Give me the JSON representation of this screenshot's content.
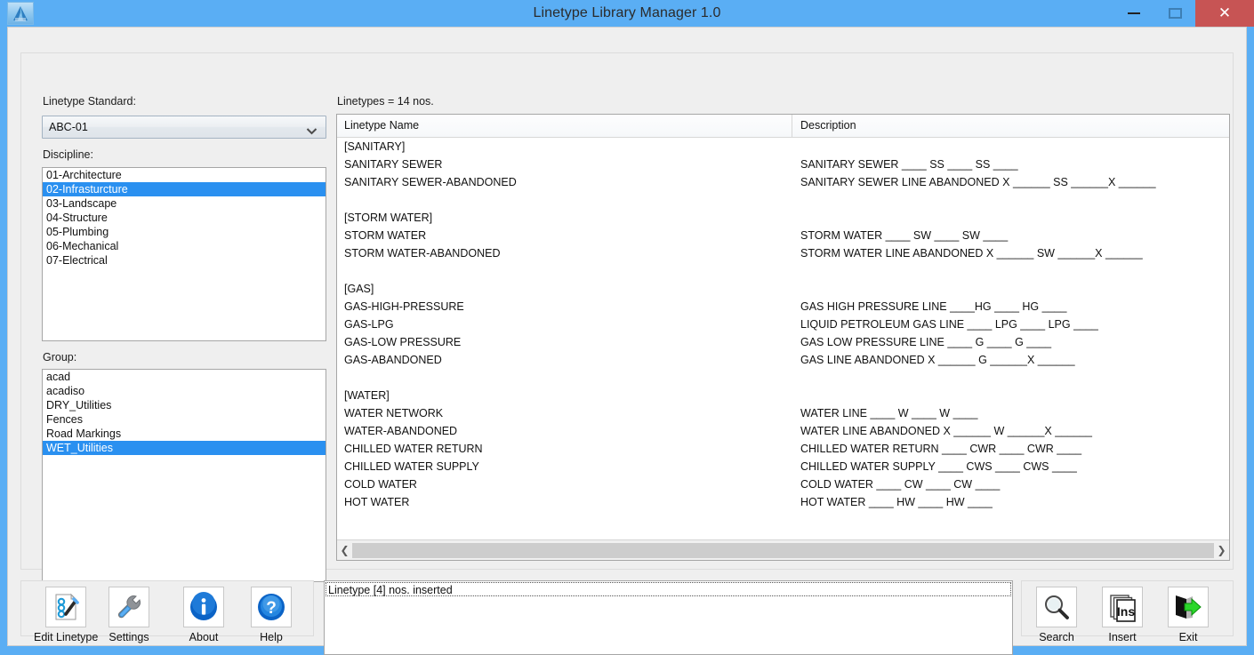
{
  "window": {
    "title": "Linetype Library Manager 1.0",
    "logo_icon": "autocad-logo-icon",
    "minimize_label": "–",
    "maximize_label": "□",
    "close_label": "✕",
    "titlebar_color": "#5aaef4",
    "close_color": "#c75454"
  },
  "left": {
    "standard_label": "Linetype Standard:",
    "standard_value": "ABC-01",
    "discipline_label": "Discipline:",
    "discipline_items": [
      {
        "label": "01-Architecture",
        "selected": false
      },
      {
        "label": "02-Infrasturcture",
        "selected": true
      },
      {
        "label": "03-Landscape",
        "selected": false
      },
      {
        "label": "04-Structure",
        "selected": false
      },
      {
        "label": "05-Plumbing",
        "selected": false
      },
      {
        "label": "06-Mechanical",
        "selected": false
      },
      {
        "label": "07-Electrical",
        "selected": false
      }
    ],
    "group_label": "Group:",
    "group_items": [
      {
        "label": "acad",
        "selected": false
      },
      {
        "label": "acadiso",
        "selected": false
      },
      {
        "label": "DRY_Utilities",
        "selected": false
      },
      {
        "label": "Fences",
        "selected": false
      },
      {
        "label": "Road Markings",
        "selected": false
      },
      {
        "label": "WET_Utilities",
        "selected": true
      }
    ],
    "selection_color": "#2a90f0"
  },
  "main": {
    "count_label": "Linetypes = 14 nos.",
    "col_name": "Linetype Name",
    "col_desc": "Description",
    "rows": [
      {
        "name": "[SANITARY]",
        "desc": ""
      },
      {
        "name": "SANITARY SEWER",
        "desc": "SANITARY SEWER ____ SS ____ SS ____"
      },
      {
        "name": "SANITARY SEWER-ABANDONED",
        "desc": "SANITARY SEWER LINE ABANDONED  X ______ SS ______X ______"
      },
      {
        "name": "",
        "desc": ""
      },
      {
        "name": "[STORM WATER]",
        "desc": ""
      },
      {
        "name": "STORM WATER",
        "desc": "STORM WATER ____ SW ____ SW ____"
      },
      {
        "name": "STORM WATER-ABANDONED",
        "desc": "STORM WATER LINE ABANDONED  X ______ SW ______X ______"
      },
      {
        "name": "",
        "desc": ""
      },
      {
        "name": "[GAS]",
        "desc": ""
      },
      {
        "name": "GAS-HIGH-PRESSURE",
        "desc": "GAS HIGH PRESSURE LINE ____HG ____ HG ____"
      },
      {
        "name": "GAS-LPG",
        "desc": "LIQUID PETROLEUM GAS LINE ____ LPG ____ LPG ____"
      },
      {
        "name": "GAS-LOW PRESSURE",
        "desc": "GAS LOW PRESSURE LINE ____ G ____ G ____"
      },
      {
        "name": "GAS-ABANDONED",
        "desc": "GAS LINE ABANDONED  X ______ G ______X ______"
      },
      {
        "name": "",
        "desc": ""
      },
      {
        "name": "[WATER]",
        "desc": ""
      },
      {
        "name": "WATER NETWORK",
        "desc": "WATER LINE ____ W ____ W ____"
      },
      {
        "name": "WATER-ABANDONED",
        "desc": "WATER LINE ABANDONED  X ______ W ______X ______"
      },
      {
        "name": "CHILLED WATER RETURN",
        "desc": "CHILLED WATER RETURN ____ CWR ____ CWR ____"
      },
      {
        "name": "CHILLED WATER SUPPLY",
        "desc": "CHILLED WATER SUPPLY ____ CWS ____ CWS ____"
      },
      {
        "name": "COLD WATER",
        "desc": "COLD WATER ____ CW ____ CW ____"
      },
      {
        "name": "HOT WATER",
        "desc": "HOT WATER ____ HW ____ HW ____"
      }
    ],
    "scroll_left_icon": "chevron-left-icon",
    "scroll_right_icon": "chevron-right-icon"
  },
  "toolbar_left": [
    {
      "label": "Edit Linetype",
      "icon": "edit-linetype-icon"
    },
    {
      "label": "Settings",
      "icon": "wrench-icon"
    },
    {
      "label": "About",
      "icon": "info-icon"
    },
    {
      "label": "Help",
      "icon": "question-icon"
    }
  ],
  "toolbar_right": [
    {
      "label": "Search",
      "icon": "magnifier-icon"
    },
    {
      "label": "Insert",
      "icon": "insert-pages-icon"
    },
    {
      "label": "Exit",
      "icon": "exit-door-arrow-icon"
    }
  ],
  "log": {
    "message": "Linetype [4] nos. inserted"
  }
}
